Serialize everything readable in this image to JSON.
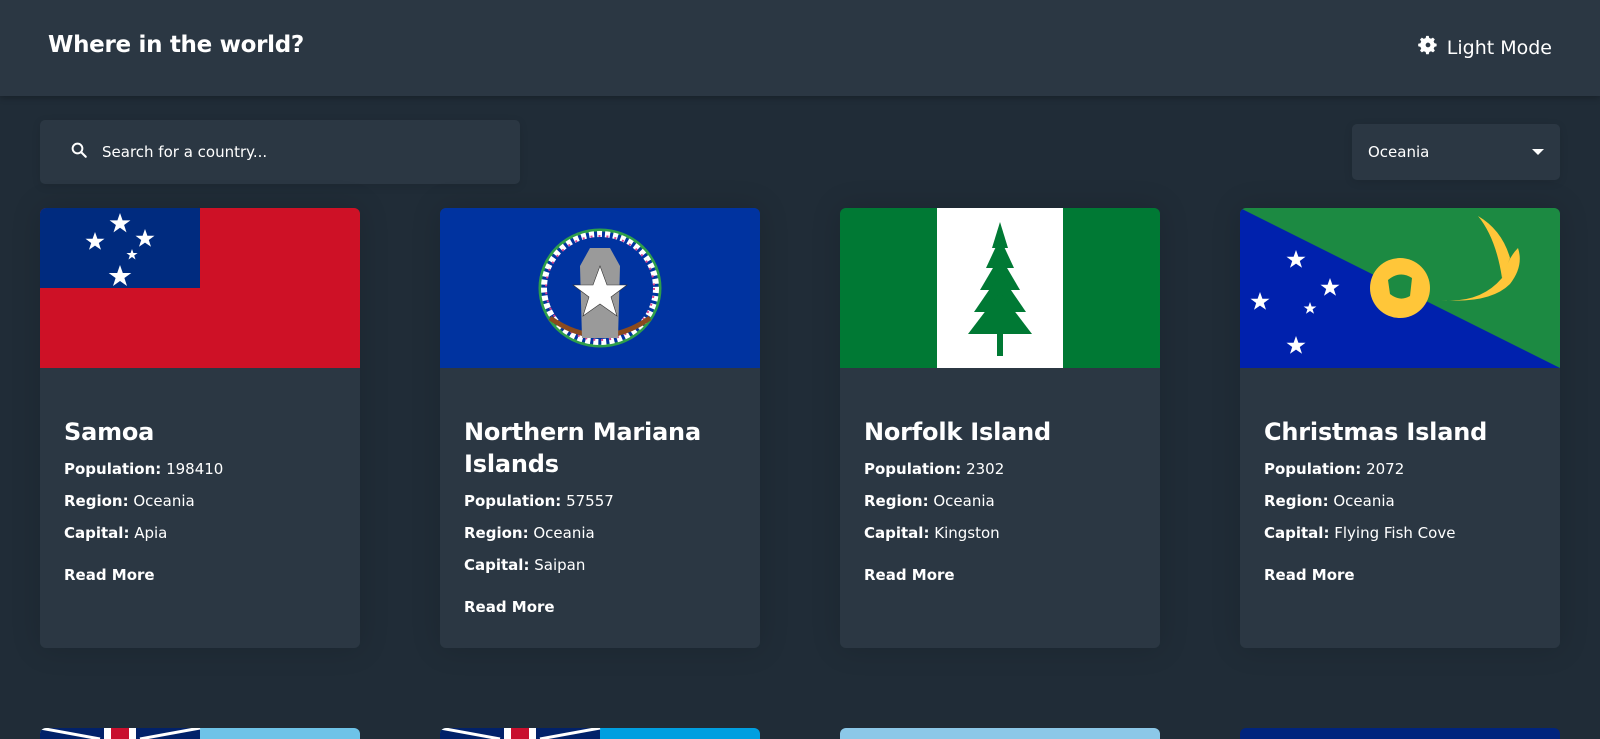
{
  "header": {
    "title": "Where in the world?",
    "mode_label": "Light Mode",
    "mode_icon": "gear-icon"
  },
  "search": {
    "placeholder": "Search for a country...",
    "icon": "search-icon"
  },
  "filter": {
    "selected": "Oceania"
  },
  "labels": {
    "population": "Population:",
    "region": "Region:",
    "capital": "Capital:",
    "read_more": "Read More"
  },
  "countries": [
    {
      "name": "Samoa",
      "population": "198410",
      "region": "Oceania",
      "capital": "Apia"
    },
    {
      "name": "Northern Mariana Islands",
      "population": "57557",
      "region": "Oceania",
      "capital": "Saipan"
    },
    {
      "name": "Norfolk Island",
      "population": "2302",
      "region": "Oceania",
      "capital": "Kingston"
    },
    {
      "name": "Christmas Island",
      "population": "2072",
      "region": "Oceania",
      "capital": "Flying Fish Cove"
    }
  ],
  "colors": {
    "background": "#202c37",
    "surface": "#2b3743",
    "text": "#ffffff"
  }
}
